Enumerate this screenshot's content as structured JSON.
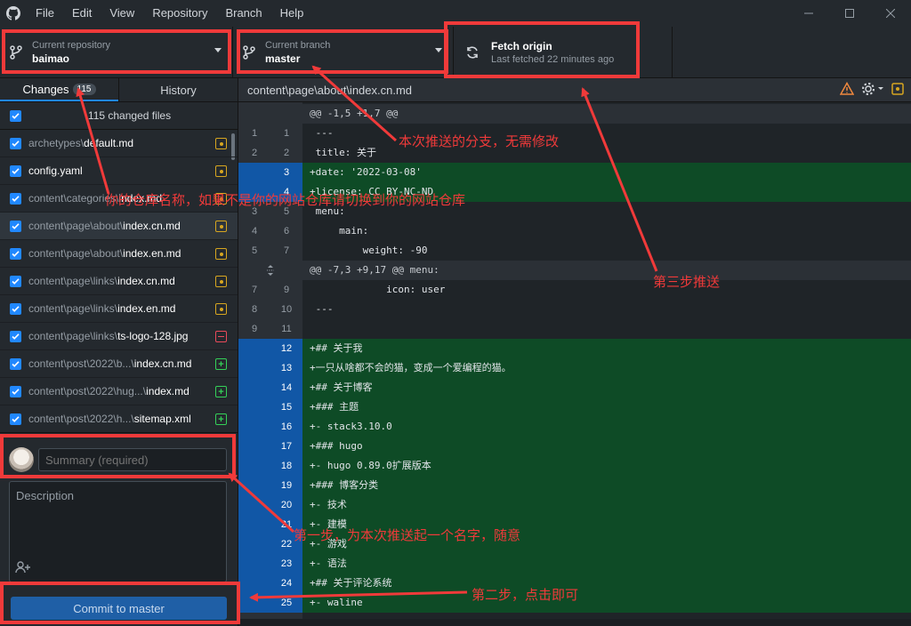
{
  "menu": [
    "File",
    "Edit",
    "View",
    "Repository",
    "Branch",
    "Help"
  ],
  "toolbar": {
    "repo_label": "Current repository",
    "repo_value": "baimao",
    "branch_label": "Current branch",
    "branch_value": "master",
    "fetch_title": "Fetch origin",
    "fetch_sub": "Last fetched 22 minutes ago"
  },
  "tabs": {
    "changes": "Changes",
    "changes_count": "115",
    "history": "History"
  },
  "files_header": "115 changed files",
  "files": [
    {
      "dir": "archetypes\\",
      "name": "default.md",
      "status": "mod"
    },
    {
      "dir": "",
      "name": "config.yaml",
      "status": "mod"
    },
    {
      "dir": "content\\categories\\",
      "name": "index.md",
      "status": "mod"
    },
    {
      "dir": "content\\page\\about\\",
      "name": "index.cn.md",
      "status": "mod",
      "selected": true
    },
    {
      "dir": "content\\page\\about\\",
      "name": "index.en.md",
      "status": "mod"
    },
    {
      "dir": "content\\page\\links\\",
      "name": "index.cn.md",
      "status": "mod"
    },
    {
      "dir": "content\\page\\links\\",
      "name": "index.en.md",
      "status": "mod"
    },
    {
      "dir": "content\\page\\links\\",
      "name": "ts-logo-128.jpg",
      "status": "del"
    },
    {
      "dir": "content\\post\\2022\\b...\\",
      "name": "index.cn.md",
      "status": "add"
    },
    {
      "dir": "content\\post\\2022\\hug...\\",
      "name": "index.md",
      "status": "add"
    },
    {
      "dir": "content\\post\\2022\\h...\\",
      "name": "sitemap.xml",
      "status": "add"
    }
  ],
  "commit": {
    "summary_placeholder": "Summary (required)",
    "description_placeholder": "Description",
    "button": "Commit to master"
  },
  "diff": {
    "path": "content\\page\\about\\index.cn.md",
    "rows": [
      {
        "type": "hunk",
        "old": "",
        "new": "",
        "text": "@@ -1,5 +1,7 @@"
      },
      {
        "type": "ctx",
        "old": "1",
        "new": "1",
        "text": " ---"
      },
      {
        "type": "ctx",
        "old": "2",
        "new": "2",
        "text": " title: 关于"
      },
      {
        "type": "add",
        "old": "",
        "new": "3",
        "text": "+date: '2022-03-08'"
      },
      {
        "type": "add",
        "old": "",
        "new": "4",
        "text": "+license: CC BY-NC-ND"
      },
      {
        "type": "ctx",
        "old": "3",
        "new": "5",
        "text": " menu:"
      },
      {
        "type": "ctx",
        "old": "4",
        "new": "6",
        "text": "     main:"
      },
      {
        "type": "ctx",
        "old": "5",
        "new": "7",
        "text": "         weight: -90"
      },
      {
        "type": "hunk",
        "old": "",
        "new": "",
        "text": "@@ -7,3 +9,17 @@ menu:"
      },
      {
        "type": "ctx",
        "old": "7",
        "new": "9",
        "text": "             icon: user"
      },
      {
        "type": "ctx",
        "old": "8",
        "new": "10",
        "text": " ---"
      },
      {
        "type": "ctx",
        "old": "9",
        "new": "11",
        "text": " "
      },
      {
        "type": "add",
        "old": "",
        "new": "12",
        "text": "+## 关于我"
      },
      {
        "type": "add",
        "old": "",
        "new": "13",
        "text": "+一只从啥都不会的猫，变成一个爱编程的猫。"
      },
      {
        "type": "add",
        "old": "",
        "new": "14",
        "text": "+## 关于博客"
      },
      {
        "type": "add",
        "old": "",
        "new": "15",
        "text": "+### 主题"
      },
      {
        "type": "add",
        "old": "",
        "new": "16",
        "text": "+- stack3.10.0"
      },
      {
        "type": "add",
        "old": "",
        "new": "17",
        "text": "+### hugo"
      },
      {
        "type": "add",
        "old": "",
        "new": "18",
        "text": "+- hugo 0.89.0扩展版本"
      },
      {
        "type": "add",
        "old": "",
        "new": "19",
        "text": "+### 博客分类"
      },
      {
        "type": "add",
        "old": "",
        "new": "20",
        "text": "+- 技术"
      },
      {
        "type": "add",
        "old": "",
        "new": "21",
        "text": "+- 建模"
      },
      {
        "type": "add",
        "old": "",
        "new": "22",
        "text": "+- 游戏"
      },
      {
        "type": "add",
        "old": "",
        "new": "23",
        "text": "+- 语法"
      },
      {
        "type": "add",
        "old": "",
        "new": "24",
        "text": "+## 关于评论系统"
      },
      {
        "type": "add",
        "old": "",
        "new": "25",
        "text": "+- waline"
      }
    ]
  },
  "annotations": {
    "branch": "本次推送的分支，无需修改",
    "repo": "你的仓库名称，如果不是你的网站仓库请切换到你的网站仓库",
    "step3": "第三步推送",
    "step1": "第一步，为本次推送起一个名字，随意",
    "step2": "第二步，点击即可"
  },
  "colors": {
    "accent": "#2188ff",
    "annotation": "#f03a3a",
    "added_bg": "#0e4b26",
    "commit_button": "#1f5fa6"
  }
}
